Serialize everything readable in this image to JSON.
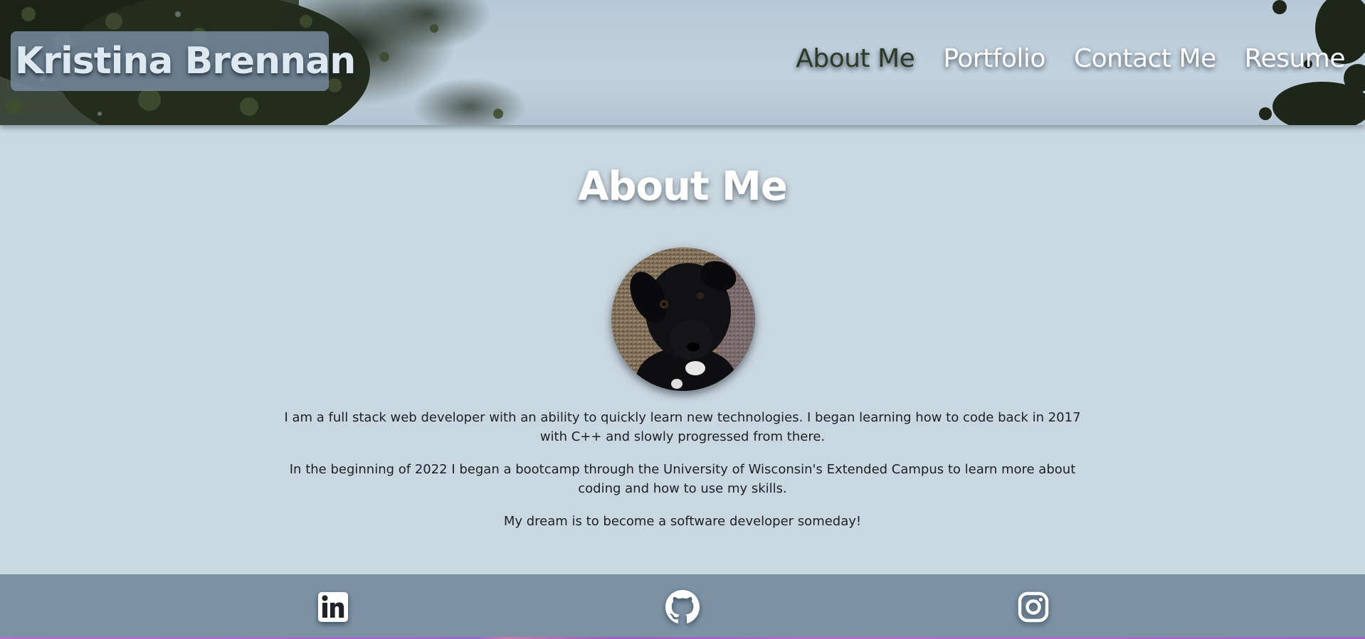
{
  "header": {
    "brand": "Kristina Brennan",
    "nav": [
      {
        "label": "About Me",
        "active": true
      },
      {
        "label": "Portfolio",
        "active": false
      },
      {
        "label": "Contact Me",
        "active": false
      },
      {
        "label": "Resume",
        "active": false
      }
    ]
  },
  "about": {
    "title": "About Me",
    "paragraphs": [
      "I am a full stack web developer with an ability to quickly learn new technologies. I began learning how to code back in 2017 with C++ and slowly progressed from there.",
      "In the beginning of 2022 I began a bootcamp through the University of Wisconsin's Extended Campus to learn more about coding and how to use my skills.",
      "My dream is to become a software developer someday!"
    ]
  },
  "footer": {
    "links": [
      {
        "icon": "linkedin-icon"
      },
      {
        "icon": "github-icon"
      },
      {
        "icon": "instagram-icon"
      }
    ]
  },
  "colors": {
    "header_sky": "#c3d2de",
    "brand_box": "#788ca0",
    "nav_active": "#2c3a26",
    "main_bg": "#c9d7e0",
    "footer_bg": "#7b92a5"
  }
}
